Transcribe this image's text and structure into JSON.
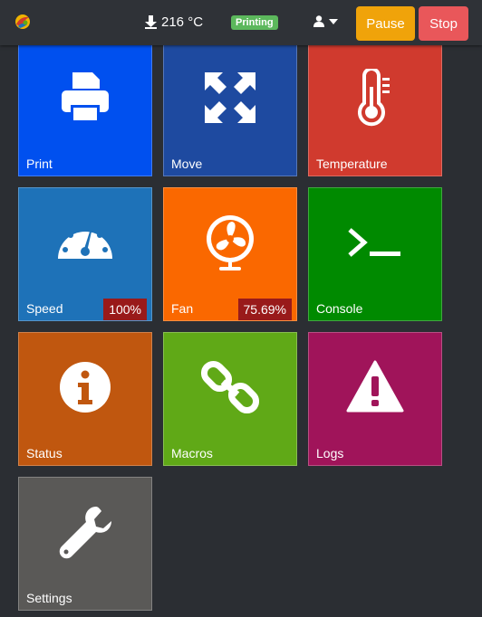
{
  "header": {
    "temperature": "216 °C",
    "status": "Printing",
    "pause_label": "Pause",
    "stop_label": "Stop"
  },
  "tiles": [
    {
      "label": "Print",
      "icon": "printer-icon",
      "color": "#0050ef"
    },
    {
      "label": "Move",
      "icon": "move-arrows-icon",
      "color": "#1e4aa0"
    },
    {
      "label": "Temperature",
      "icon": "thermometer-icon",
      "color": "#d03a2e"
    },
    {
      "label": "Speed",
      "icon": "speedometer-icon",
      "color": "#1e72b8",
      "value": "100%"
    },
    {
      "label": "Fan",
      "icon": "fan-icon",
      "color": "#fa6800",
      "value": "75.69%"
    },
    {
      "label": "Console",
      "icon": "terminal-icon",
      "color": "#008a00"
    },
    {
      "label": "Status",
      "icon": "info-icon",
      "color": "#c0570f"
    },
    {
      "label": "Macros",
      "icon": "chain-link-icon",
      "color": "#60a917"
    },
    {
      "label": "Logs",
      "icon": "warning-icon",
      "color": "#a0145a"
    },
    {
      "label": "Settings",
      "icon": "wrench-icon",
      "color": "#5a5957"
    }
  ]
}
